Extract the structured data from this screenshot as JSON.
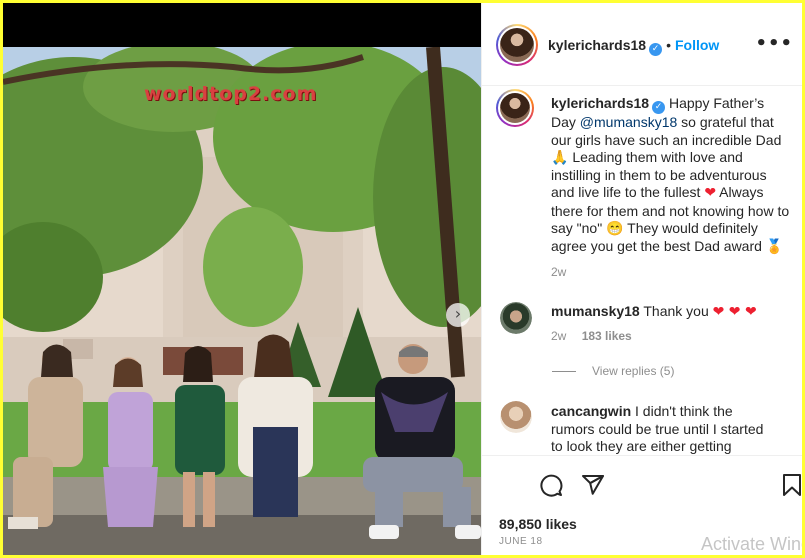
{
  "photo": {
    "watermark": "worldtop2.com",
    "next_icon": "chevron-right-icon"
  },
  "header": {
    "username": "kylerichards18",
    "verified_icon": "verified-badge-icon",
    "dot": "•",
    "follow_label": "Follow",
    "more_icon": "more-options-icon",
    "more_glyph": "•••"
  },
  "caption": {
    "username": "kylerichards18",
    "text_1": "Happy Father’s Day",
    "mention": "@mumansky18",
    "text_2": " so grateful that our girls have such an incredible Dad 🙏 Leading them with love and instilling in them to be adventurous and live life to the fullest ",
    "heart": "❤",
    "text_3": " Always there for them and not knowing how to say \"no\" 😁 They would definitely agree you get the best Dad award 🏅",
    "time": "2w"
  },
  "comments": [
    {
      "username": "mumansky18",
      "text": "Thank you",
      "hearts": "❤ ❤ ❤",
      "time": "2w",
      "likes": "183 likes",
      "view_replies": "View replies (5)"
    },
    {
      "username": "cancangwin",
      "text": "I didn't think the rumors could be true until I started to look they are either getting"
    }
  ],
  "actions": {
    "comment_icon": "comment-icon",
    "share_icon": "share-icon",
    "save_icon": "bookmark-icon",
    "likes": "89,850 likes",
    "date": "JUNE 18"
  },
  "overlay": {
    "activate": "Activate Wind"
  },
  "colors": {
    "page_border": "#ffff33",
    "accent": "#0095f6",
    "text": "#262626",
    "muted": "#8e8e8e",
    "heart": "#ed2030"
  }
}
